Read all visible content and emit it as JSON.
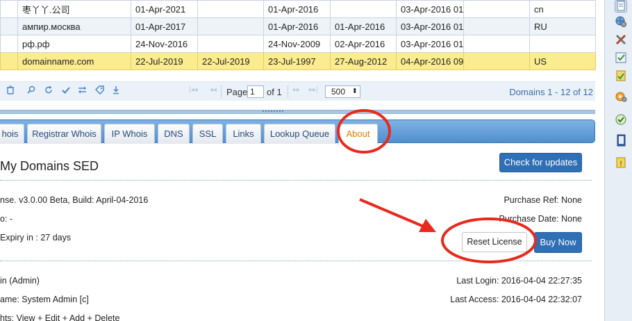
{
  "grid": {
    "rows": [
      [
        "",
        "枣丫丫.公司",
        "01-Apr-2021",
        "",
        "01-Apr-2016",
        "",
        "03-Apr-2016 01",
        "",
        "cn"
      ],
      [
        "",
        "ампир.москва",
        "01-Apr-2017",
        "",
        "01-Apr-2016",
        "01-Apr-2016",
        "03-Apr-2016 01",
        "",
        "RU"
      ],
      [
        "",
        "рф.рф",
        "24-Nov-2016",
        "",
        "24-Nov-2009",
        "02-Apr-2016",
        "03-Apr-2016 01",
        "",
        ""
      ],
      [
        "",
        "domainname.com",
        "22-Jul-2019",
        "22-Jul-2019",
        "23-Jul-1997",
        "27-Aug-2012",
        "04-Apr-2016 09",
        "",
        "US"
      ]
    ]
  },
  "pager": {
    "page_label": "Page",
    "page_value": "1",
    "of_label": "of 1",
    "per_page": "500",
    "count": "Domains 1 - 12 of 12",
    "icons": [
      "trash-icon",
      "search-icon",
      "refresh-icon",
      "check-icon",
      "swap-icon",
      "tag-icon",
      "download-icon"
    ]
  },
  "tabs": [
    {
      "label": "hois",
      "active": false
    },
    {
      "label": "Registrar Whois",
      "active": false
    },
    {
      "label": "IP Whois",
      "active": false
    },
    {
      "label": "DNS",
      "active": false
    },
    {
      "label": "SSL",
      "active": false
    },
    {
      "label": "Links",
      "active": false
    },
    {
      "label": "Lookup Queue",
      "active": false
    },
    {
      "label": "About",
      "active": true
    }
  ],
  "about": {
    "title": "My Domains SED",
    "check_updates": "Check for updates",
    "license_line": "nse. v3.0.00 Beta, Build: April-04-2016",
    "line2": "o: -",
    "expiry": " Expiry in : 27 days",
    "purchase_ref": "Purchase Ref: None",
    "purchase_date": "Purchase Date: None",
    "reset_license": "Reset License",
    "buy_now": "Buy Now",
    "user_line1": "in  (Admin)",
    "user_line2": "ame: System Admin [c]",
    "user_line3": "hts: View + Edit + Add + Delete",
    "last_login": "Last Login: 2016-04-04 22:27:35",
    "last_access": "Last Access: 2016-04-04 22:32:07"
  },
  "colors": {
    "accent": "#2f6fb5",
    "selected_row": "#fbec8f",
    "active_tab_text": "#e07b00",
    "annotation": "#e8291c"
  },
  "sidebar_icons": [
    "report-icon",
    "globe-gear-icon",
    "tools-icon",
    "checklist-icon",
    "clipboard-check-icon",
    "settings-icon",
    "task-check-icon",
    "book-icon",
    "warning-icon"
  ]
}
